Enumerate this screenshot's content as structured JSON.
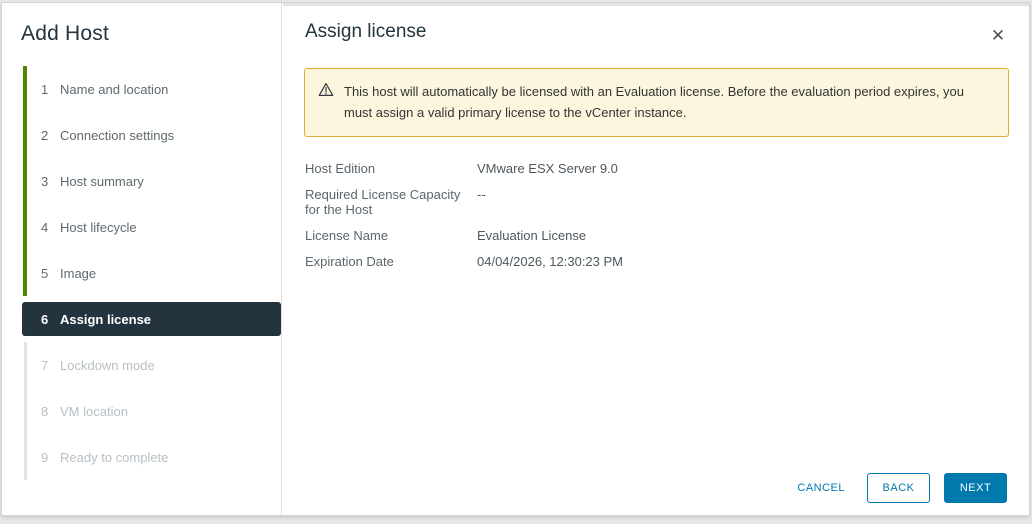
{
  "wizard": {
    "title": "Add Host",
    "steps": [
      {
        "num": "1",
        "label": "Name and location",
        "state": "done"
      },
      {
        "num": "2",
        "label": "Connection settings",
        "state": "done"
      },
      {
        "num": "3",
        "label": "Host summary",
        "state": "done"
      },
      {
        "num": "4",
        "label": "Host lifecycle",
        "state": "done"
      },
      {
        "num": "5",
        "label": "Image",
        "state": "done"
      },
      {
        "num": "6",
        "label": "Assign license",
        "state": "active"
      },
      {
        "num": "7",
        "label": "Lockdown mode",
        "state": "disabled"
      },
      {
        "num": "8",
        "label": "VM location",
        "state": "disabled"
      },
      {
        "num": "9",
        "label": "Ready to complete",
        "state": "disabled"
      }
    ]
  },
  "panel": {
    "title": "Assign license",
    "close_icon": "✕"
  },
  "banner": {
    "icon": "warning-triangle-icon",
    "text": "This host will automatically be licensed with an Evaluation license. Before the evaluation period expires, you must assign a valid primary license to the vCenter instance."
  },
  "details": [
    {
      "label": "Host Edition",
      "value": "VMware ESX Server 9.0"
    },
    {
      "label": "Required License Capacity for the Host",
      "value": "--"
    },
    {
      "label": "License Name",
      "value": "Evaluation License"
    },
    {
      "label": "Expiration Date",
      "value": "04/04/2026, 12:30:23 PM"
    }
  ],
  "footer": {
    "cancel_label": "CANCEL",
    "back_label": "BACK",
    "next_label": "NEXT"
  },
  "colors": {
    "accent_blue": "#0079ad",
    "step_done_green": "#4d8802",
    "active_step_bg": "#24343f",
    "banner_bg": "#fdf6df",
    "banner_border": "#dfae38"
  }
}
